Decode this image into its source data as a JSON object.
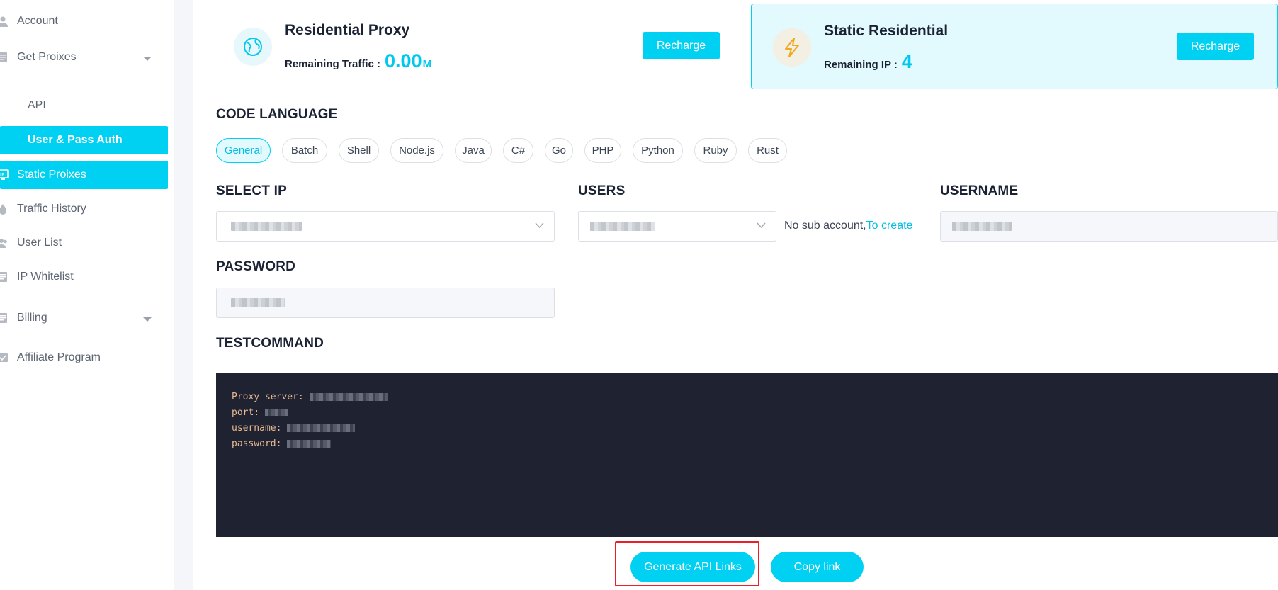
{
  "sidebar": {
    "items": [
      {
        "label": "Account",
        "icon": "user-icon"
      },
      {
        "label": "Get Proixes",
        "icon": "document-icon",
        "expandable": true
      },
      {
        "label": "API"
      },
      {
        "label": "User & Pass Auth",
        "active": true
      },
      {
        "label": "Static Proixes",
        "icon": "ip-icon",
        "active": true
      },
      {
        "label": "Traffic History",
        "icon": "drop-icon"
      },
      {
        "label": "User List",
        "icon": "users-icon"
      },
      {
        "label": "IP Whitelist",
        "icon": "list-icon"
      },
      {
        "label": "Billing",
        "icon": "document-icon",
        "expandable": true
      },
      {
        "label": "Affiliate Program",
        "icon": "share-icon"
      }
    ]
  },
  "cards": {
    "residential": {
      "title": "Residential Proxy",
      "remaining_label": "Remaining Traffic :",
      "remaining_value": "0.00",
      "remaining_unit": "M",
      "button": "Recharge",
      "icon": "globe-icon"
    },
    "static": {
      "title": "Static Residential",
      "remaining_label": "Remaining IP :",
      "remaining_value": "4",
      "button": "Recharge",
      "icon": "lightning-icon"
    }
  },
  "code_language": {
    "label": "CODE LANGUAGE",
    "options": [
      "General",
      "Batch",
      "Shell",
      "Node.js",
      "Java",
      "C#",
      "Go",
      "PHP",
      "Python",
      "Ruby",
      "Rust"
    ],
    "selected": "General"
  },
  "form": {
    "select_ip_label": "SELECT IP",
    "users_label": "USERS",
    "username_label": "USERNAME",
    "password_label": "PASSWORD",
    "no_sub_account_text": "No sub account,",
    "to_create_link": "To create"
  },
  "testcommand": {
    "label": "TESTCOMMAND",
    "lines": [
      "Proxy server:",
      "port:",
      "username:",
      "password:"
    ]
  },
  "actions": {
    "generate": "Generate API Links",
    "copy": "Copy link"
  },
  "colors": {
    "accent": "#00d1f2",
    "terminal_bg": "#1e2231",
    "terminal_text": "#e8b991",
    "highlight": "#ea1f2a"
  }
}
